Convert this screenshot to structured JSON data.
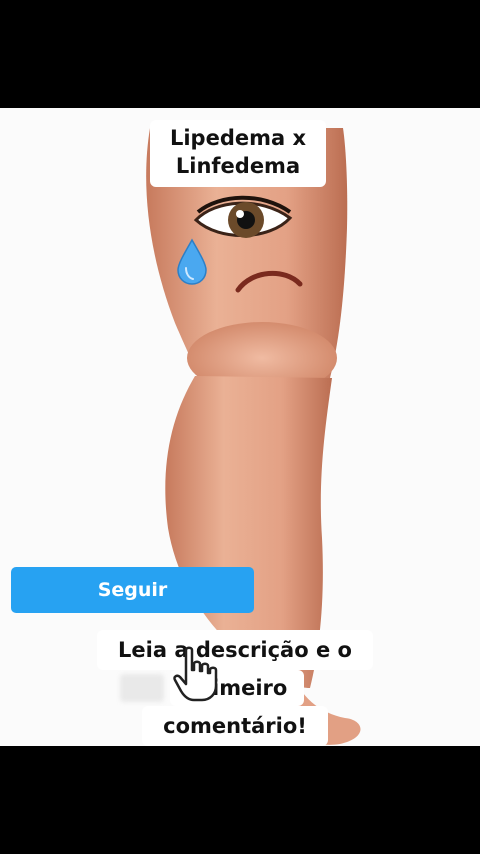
{
  "video": {
    "title_line1": "Lipedema x",
    "title_line2": "Linfedema"
  },
  "follow_button": {
    "label": "Seguir"
  },
  "caption": {
    "line1": "Leia a descrição e o",
    "line2": "primeiro",
    "line3": "comentário!"
  },
  "icons": {
    "tear": "teardrop-icon",
    "hand": "hand-pointer-icon",
    "eye": "eye-icon"
  },
  "colors": {
    "button": "#27a2f2",
    "skin": "#e8a98a",
    "tear": "#4aa8f0",
    "background": "#000000"
  }
}
